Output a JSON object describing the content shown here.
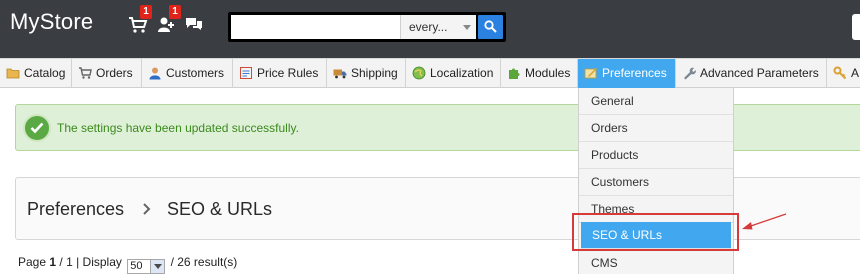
{
  "header": {
    "logo": "MyStore",
    "cart_badge": "1",
    "customers_badge": "1",
    "search": {
      "placeholder": "",
      "scope": "every..."
    }
  },
  "nav": {
    "items": [
      {
        "label": "Catalog",
        "icon": "folder-icon"
      },
      {
        "label": "Orders",
        "icon": "cart-icon"
      },
      {
        "label": "Customers",
        "icon": "user-icon"
      },
      {
        "label": "Price Rules",
        "icon": "price-tag-icon"
      },
      {
        "label": "Shipping",
        "icon": "truck-icon"
      },
      {
        "label": "Localization",
        "icon": "globe-icon"
      },
      {
        "label": "Modules",
        "icon": "puzzle-icon"
      },
      {
        "label": "Preferences",
        "icon": "preferences-icon",
        "active": true
      },
      {
        "label": "Advanced Parameters",
        "icon": "wrench-icon"
      },
      {
        "label": "A",
        "icon": "key-icon"
      }
    ]
  },
  "alert": {
    "message": "The settings have been updated successfully."
  },
  "breadcrumb": {
    "parent": "Preferences",
    "current": "SEO & URLs"
  },
  "pager": {
    "page_label": "Page",
    "page_current": "1",
    "page_total": "/ 1",
    "display_label": "| Display",
    "per_page": "50",
    "results": "/ 26 result(s)"
  },
  "dropdown": {
    "items": [
      "General",
      "Orders",
      "Products",
      "Customers",
      "Themes",
      "SEO & URLs",
      "CMS"
    ],
    "selected": "SEO & URLs"
  },
  "colors": {
    "accent": "#41a8ef",
    "header_bg": "#3a3d42",
    "success": "#3c8a1e",
    "annotation": "#d63a3a"
  }
}
